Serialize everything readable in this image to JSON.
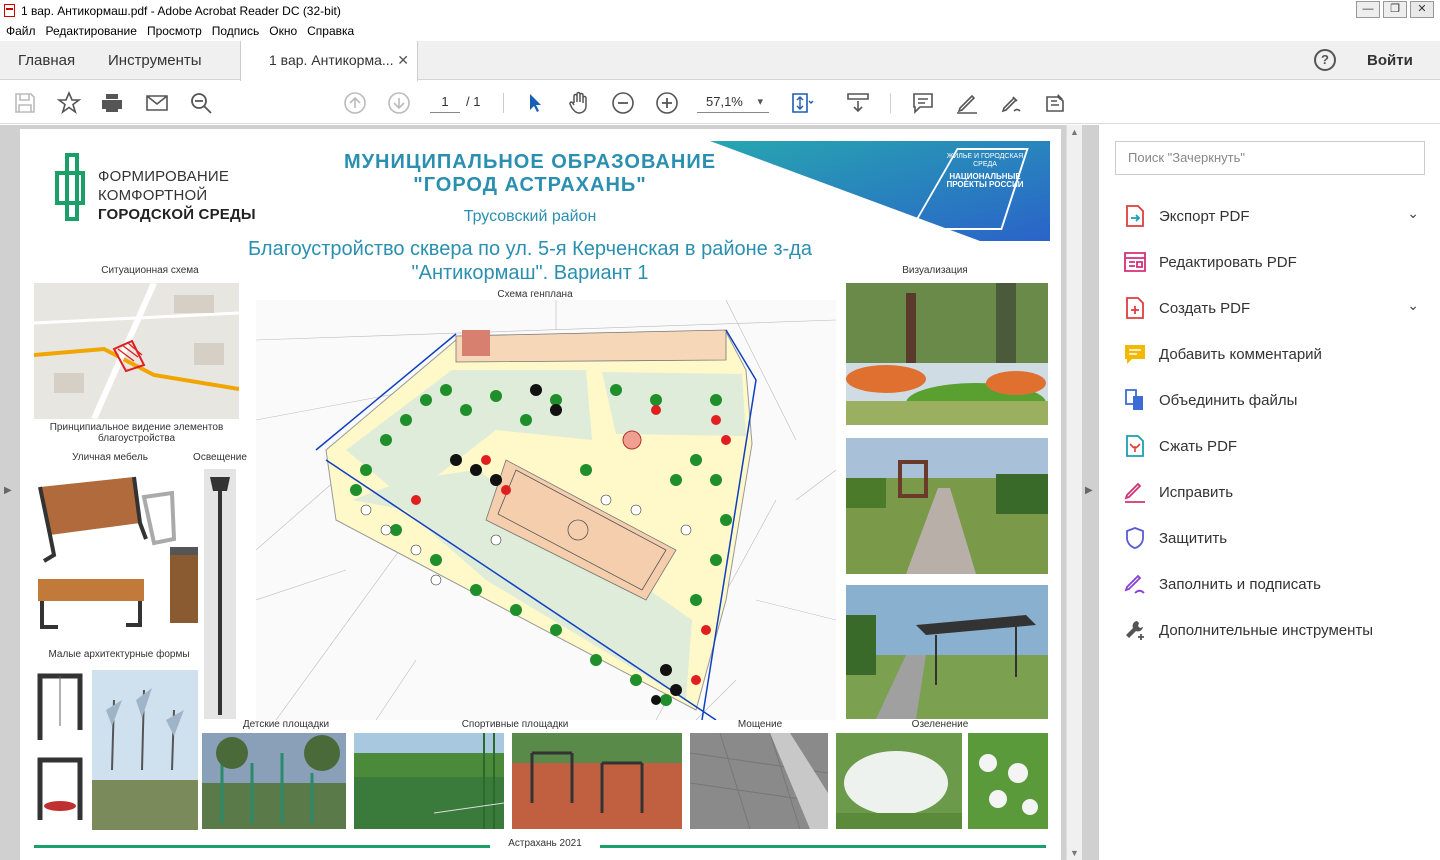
{
  "window": {
    "title": "1 вар. Антикормаш.pdf - Adobe Acrobat Reader DC (32-bit)",
    "buttons": {
      "minimize": "—",
      "restore": "❐",
      "close": "✕"
    }
  },
  "menu": [
    "Файл",
    "Редактирование",
    "Просмотр",
    "Подпись",
    "Окно",
    "Справка"
  ],
  "tabs": {
    "home": "Главная",
    "tools": "Инструменты",
    "document": "1 вар. Антикорма...",
    "close": "✕"
  },
  "header_right": {
    "help": "?",
    "login": "Войти"
  },
  "toolbar": {
    "page_current": "1",
    "page_total": "/ 1",
    "zoom": "57,1%"
  },
  "document": {
    "logo_line1": "ФОРМИРОВАНИЕ",
    "logo_line2": "КОМФОРТНОЙ",
    "logo_line3": "ГОРОДСКОЙ СРЕДЫ",
    "municipality_line1": "МУНИЦИПАЛЬНОЕ ОБРАЗОВАНИЕ",
    "municipality_line2": "\"ГОРОД АСТРАХАНЬ\"",
    "district": "Трусовский район",
    "national_projects": {
      "small": "ЖИЛЬЕ И ГОРОДСКАЯ СРЕДА",
      "big": "НАЦИОНАЛЬНЫЕ ПРОЕКТЫ РОССИИ"
    },
    "title_line1": "Благоустройство сквера по ул. 5-я Керченская в районе з-да",
    "title_line2": "\"Антикормаш\". Вариант 1",
    "labels": {
      "situational": "Ситуационная схема",
      "principal": "Принципиальное видение элементов благоустройства",
      "furniture": "Уличная мебель",
      "lighting": "Освещение",
      "small_forms": "Малые архитектурные формы",
      "master_plan": "Схема генплана",
      "visualization": "Визуализация",
      "playgrounds": "Детские площадки",
      "sports": "Спортивные площадки",
      "paving": "Мощение",
      "greening": "Озеленение"
    },
    "footer": "Астрахань 2021"
  },
  "right_panel": {
    "search_placeholder": "Поиск \"Зачеркнуть\"",
    "tools": [
      {
        "label": "Экспорт PDF",
        "icon": "export-pdf-icon",
        "color": "#e03c3c",
        "expand": true
      },
      {
        "label": "Редактировать PDF",
        "icon": "edit-pdf-icon",
        "color": "#d2307a",
        "expand": false
      },
      {
        "label": "Создать PDF",
        "icon": "create-pdf-icon",
        "color": "#e03c3c",
        "expand": true
      },
      {
        "label": "Добавить комментарий",
        "icon": "comment-icon",
        "color": "#f5b800",
        "expand": false
      },
      {
        "label": "Объединить файлы",
        "icon": "combine-files-icon",
        "color": "#3c6bd6",
        "expand": false
      },
      {
        "label": "Сжать PDF",
        "icon": "compress-pdf-icon",
        "color": "#e03c3c",
        "expand": false
      },
      {
        "label": "Исправить",
        "icon": "fill-sign-icon",
        "color": "#d2307a",
        "expand": false
      },
      {
        "label": "Защитить",
        "icon": "protect-shield-icon",
        "color": "#5a5ad6",
        "expand": false
      },
      {
        "label": "Заполнить и подписать",
        "icon": "sign-pen-icon",
        "color": "#8a3fd6",
        "expand": false
      },
      {
        "label": "Дополнительные инструменты",
        "icon": "more-tools-icon",
        "color": "#555555",
        "expand": false
      }
    ]
  }
}
